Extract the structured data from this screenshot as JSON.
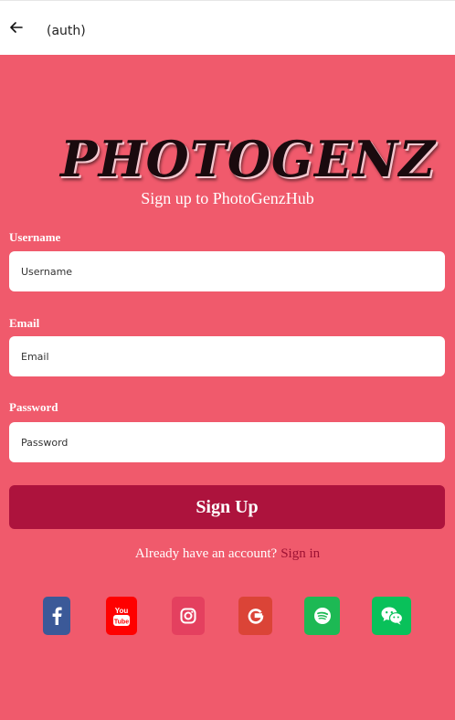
{
  "header": {
    "title": "(auth)",
    "back_icon": "arrow-left-icon"
  },
  "brand": {
    "logo_text": "PHOTOGENZ",
    "subtitle": "Sign up to PhotoGenzHub"
  },
  "form": {
    "username": {
      "label": "Username",
      "placeholder": "Username"
    },
    "email": {
      "label": "Email",
      "placeholder": "Email"
    },
    "password": {
      "label": "Password",
      "placeholder": "Password"
    },
    "submit_label": "Sign Up"
  },
  "signin": {
    "question": "Already have an account?",
    "link_label": "Sign in"
  },
  "social": [
    {
      "name": "facebook-icon",
      "color": "#3b5998"
    },
    {
      "name": "youtube-icon",
      "color": "#ff0000"
    },
    {
      "name": "instagram-icon",
      "color": "#e4405f"
    },
    {
      "name": "google-icon",
      "color": "#db4437"
    },
    {
      "name": "spotify-icon",
      "color": "#1db954"
    },
    {
      "name": "wechat-icon",
      "color": "#09c15a"
    }
  ],
  "colors": {
    "background": "#f05a6c",
    "button": "#ad133d",
    "link": "#9e1133"
  }
}
